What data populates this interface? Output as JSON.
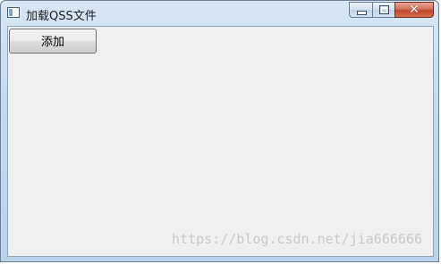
{
  "window": {
    "title": "加载QSS文件",
    "app_icon": "app-window-icon",
    "controls": {
      "minimize_icon": "minimize-icon",
      "maximize_icon": "maximize-icon",
      "close_icon": "close-icon",
      "close_glyph": "✕"
    }
  },
  "main": {
    "add_button_label": "添加"
  },
  "watermark": "https://blog.csdn.net/jia666666",
  "colors": {
    "client_bg": "#f0f0f0",
    "close_red": "#c2472c",
    "frame_blue": "#bcd2ea"
  }
}
